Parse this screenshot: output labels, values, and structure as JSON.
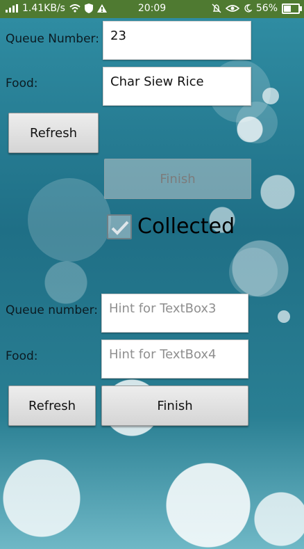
{
  "status_bar": {
    "network_speed": "1.41KB/s",
    "time": "20:09",
    "battery_percent": "56%",
    "battery_level": 0.56
  },
  "form_top": {
    "queue_label": "Queue Number:",
    "queue_value": "23",
    "food_label": "Food:",
    "food_value": "Char Siew Rice",
    "refresh_label": "Refresh",
    "finish_label": "Finish",
    "collected_label": "Collected"
  },
  "form_bottom": {
    "queue_label": "Queue number:",
    "queue_placeholder": "Hint for TextBox3",
    "food_label": "Food:",
    "food_placeholder": "Hint for TextBox4",
    "refresh_label": "Refresh",
    "finish_label": "Finish"
  }
}
